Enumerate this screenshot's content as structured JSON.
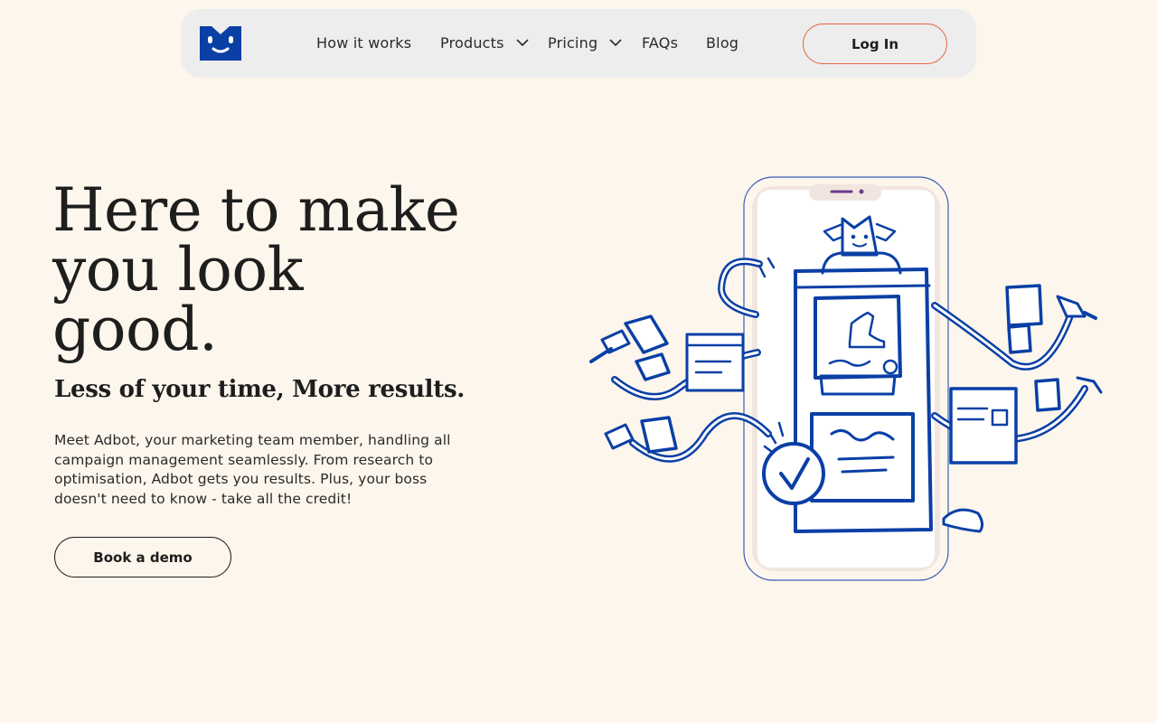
{
  "nav": {
    "links": [
      {
        "label": "How it works"
      },
      {
        "label": "Products",
        "has_dropdown": true
      },
      {
        "label": "Pricing",
        "has_dropdown": true
      },
      {
        "label": "FAQs"
      },
      {
        "label": "Blog"
      }
    ],
    "login_label": "Log In",
    "logo_icon": "adbot-face-logo-icon"
  },
  "hero": {
    "headline_lines": [
      "Here to make",
      "you look",
      "good."
    ],
    "subheading": "Less of your time, More results.",
    "body": "Meet Adbot, your marketing team member, handling all campaign management seamlessly. From research to optimisation, Adbot gets you results. Plus, your boss doesn't need to know - take all the credit!",
    "cta_label": "Book a demo",
    "illustration_icon": "phone-with-robot-arms-illustration-icon"
  },
  "colors": {
    "background": "#fdf6ec",
    "nav_background": "#ededee",
    "brand_blue": "#0a3fa6",
    "login_border": "#e8683f"
  }
}
